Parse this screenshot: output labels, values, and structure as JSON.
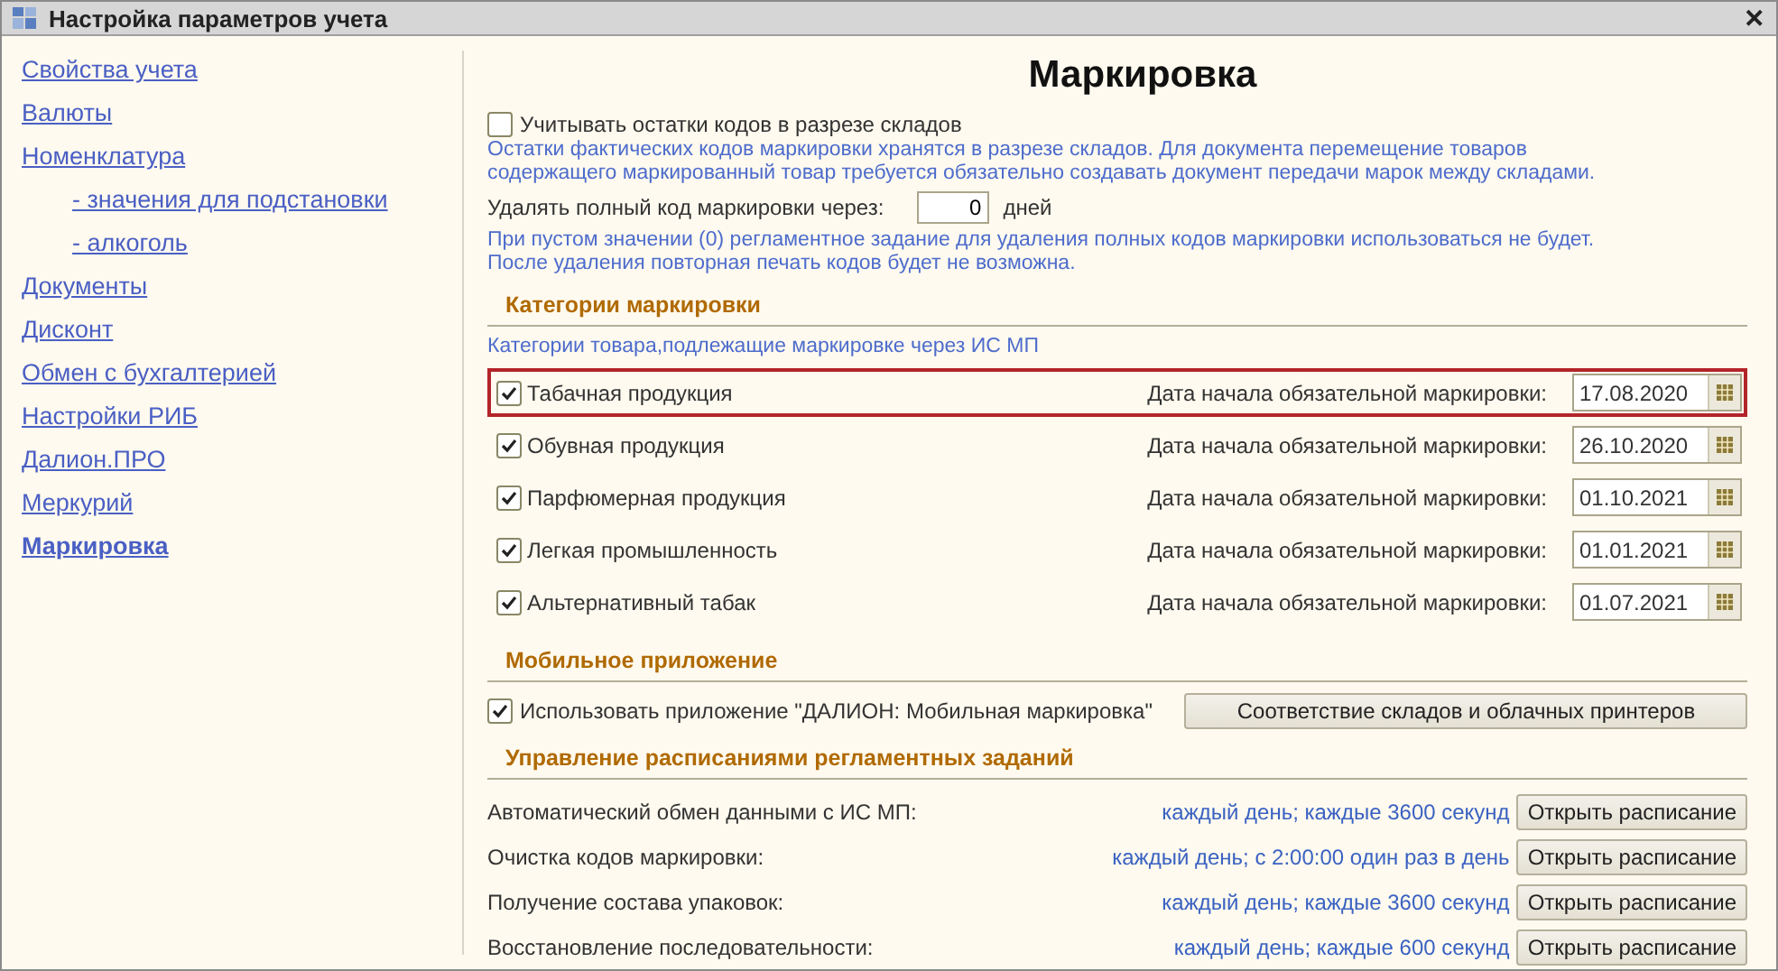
{
  "window": {
    "title": "Настройка параметров учета",
    "close": "✕"
  },
  "sidebar": {
    "items": [
      {
        "label": "Свойства учета",
        "selected": false
      },
      {
        "label": "Валюты",
        "selected": false
      },
      {
        "label": "Номенклатура",
        "selected": false,
        "children": [
          {
            "label": "- значения для подстановки",
            "selected": false
          },
          {
            "label": "- алкоголь",
            "selected": false
          }
        ]
      },
      {
        "label": "Документы",
        "selected": false
      },
      {
        "label": "Дисконт",
        "selected": false
      },
      {
        "label": "Обмен с бухгалтерией",
        "selected": false
      },
      {
        "label": "Настройки РИБ",
        "selected": false
      },
      {
        "label": "Далион.ПРО",
        "selected": false
      },
      {
        "label": "Меркурий",
        "selected": false
      },
      {
        "label": "Маркировка",
        "selected": true
      }
    ]
  },
  "page": {
    "title": "Маркировка",
    "warehouse_option": {
      "label": "Учитывать остатки кодов в разрезе складов",
      "checked": false
    },
    "warehouse_note": "Остатки фактических кодов маркировки хранятся в разрезе складов. Для документа перемещение товаров содержащего маркированный товар требуется обязательно создавать документ передачи марок между складами.",
    "delete_after": {
      "label": "Удалять полный код маркировки через:",
      "value": "0",
      "unit": "дней"
    },
    "delete_note": [
      "При пустом значении (0) регламентное задание для удаления полных кодов маркировки использоваться не будет.",
      "После удаления повторная печать кодов будет не возможна."
    ]
  },
  "categories": {
    "title": "Категории маркировки",
    "note": "Категории товара,подлежащие маркировке через ИС МП",
    "items": [
      {
        "label": "Табачная продукция",
        "checked": true,
        "selected": true,
        "date_label": "Дата начала обязательной маркировки:",
        "date": "17.08.2020"
      },
      {
        "label": "Обувная продукция",
        "checked": true,
        "selected": false,
        "date_label": "Дата начала обязательной маркировки:",
        "date": "26.10.2020"
      },
      {
        "label": "Парфюмерная продукция",
        "checked": true,
        "selected": false,
        "date_label": "Дата начала обязательной маркировки:",
        "date": "01.10.2021"
      },
      {
        "label": "Легкая промышленность",
        "checked": true,
        "selected": false,
        "date_label": "Дата начала обязательной маркировки:",
        "date": "01.01.2021"
      },
      {
        "label": "Альтернативный табак",
        "checked": true,
        "selected": false,
        "date_label": "Дата начала обязательной маркировки:",
        "date": "01.07.2021"
      }
    ]
  },
  "mobile": {
    "title": "Мобильное приложение",
    "option": {
      "label": "Использовать приложение \"ДАЛИОН: Мобильная маркировка\"",
      "checked": true
    },
    "button": "Соответствие складов и облачных принтеров"
  },
  "schedules": {
    "title": "Управление расписаниями регламентных заданий",
    "items": [
      {
        "label": "Автоматический обмен данными с ИС МП:",
        "schedule": "каждый день; каждые 3600 секунд",
        "button": "Открыть расписание"
      },
      {
        "label": "Очистка кодов маркировки:",
        "schedule": "каждый день; с 2:00:00 один раз в день",
        "button": "Открыть расписание"
      },
      {
        "label": "Получение состава упаковок:",
        "schedule": "каждый день; каждые 3600 секунд",
        "button": "Открыть расписание"
      },
      {
        "label": "Восстановление последовательности:",
        "schedule": "каждый день; каждые 600 секунд",
        "button": "Открыть расписание"
      }
    ]
  }
}
